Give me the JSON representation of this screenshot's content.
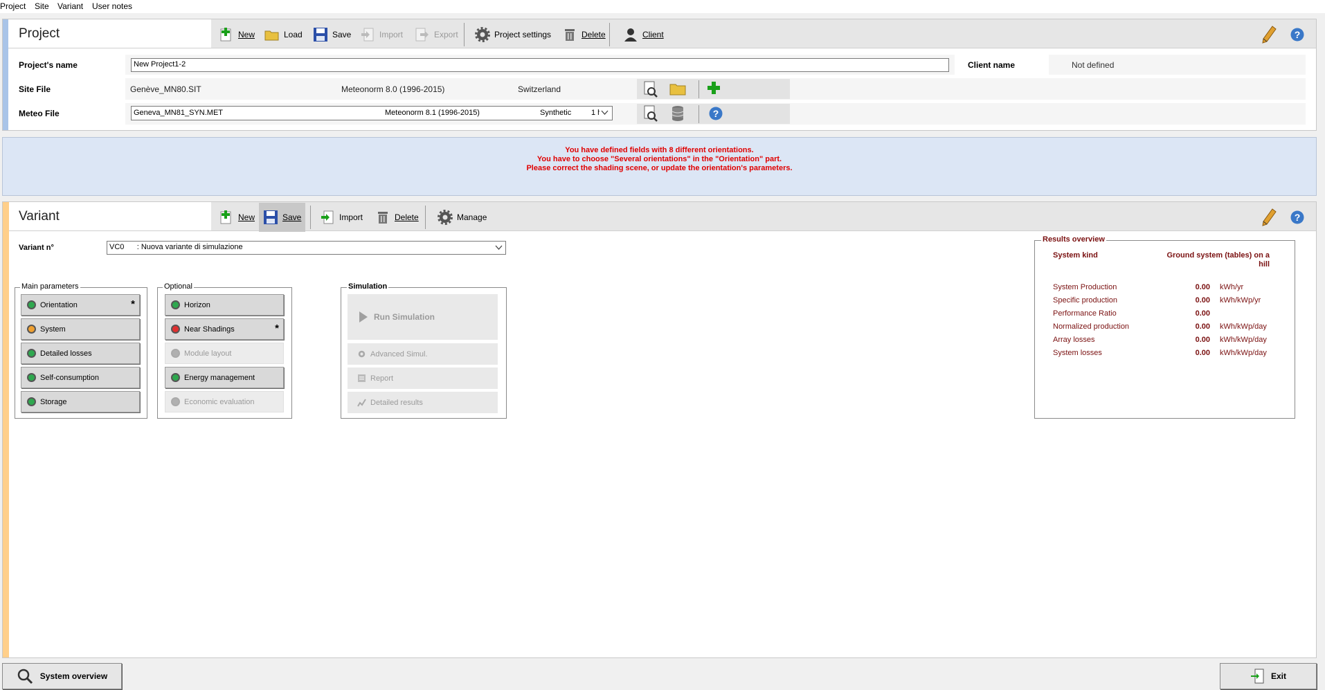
{
  "menu": [
    "Project",
    "Site",
    "Variant",
    "User notes"
  ],
  "project": {
    "title": "Project",
    "toolbar": {
      "new": "New",
      "load": "Load",
      "save": "Save",
      "import": "Import",
      "export": "Export",
      "settings": "Project settings",
      "delete": "Delete",
      "client": "Client"
    },
    "name_label": "Project's name",
    "name_value": "New Project1-2",
    "client_label": "Client name",
    "client_value": "Not defined",
    "site_label": "Site File",
    "site_file": "Genève_MN80.SIT",
    "site_source": "Meteonorm 8.0 (1996-2015)",
    "site_country": "Switzerland",
    "meteo_label": "Meteo File",
    "meteo_file": "Geneva_MN81_SYN.MET",
    "meteo_source": "Meteonorm 8.1 (1996-2015)",
    "meteo_type": "Synthetic",
    "meteo_step": "1 h"
  },
  "warning": {
    "line1": "You have defined fields with 8 different orientations.",
    "line2": "You have to choose \"Several orientations\" in the \"Orientation\" part.",
    "line3": "Please correct the shading scene, or update the orientation's parameters.",
    "color": "#e00000"
  },
  "variant": {
    "title": "Variant",
    "toolbar": {
      "new": "New",
      "save": "Save",
      "import": "Import",
      "delete": "Delete",
      "manage": "Manage"
    },
    "number_label": "Variant n°",
    "number_value": "VC0      : Nuova variante di simulazione"
  },
  "main_parameters": {
    "title": "Main parameters",
    "buttons": [
      {
        "label": "Orientation",
        "status": "green",
        "star": "*"
      },
      {
        "label": "System",
        "status": "orange",
        "star": ""
      },
      {
        "label": "Detailed losses",
        "status": "green",
        "star": ""
      },
      {
        "label": "Self-consumption",
        "status": "green",
        "star": ""
      },
      {
        "label": "Storage",
        "status": "green",
        "star": ""
      }
    ]
  },
  "optional": {
    "title": "Optional",
    "buttons": [
      {
        "label": "Horizon",
        "status": "green",
        "star": ""
      },
      {
        "label": "Near Shadings",
        "status": "red",
        "star": "*"
      },
      {
        "label": "Module layout",
        "status": "grey",
        "star": ""
      },
      {
        "label": "Energy management",
        "status": "green",
        "star": ""
      },
      {
        "label": "Economic evaluation",
        "status": "grey",
        "star": ""
      }
    ]
  },
  "simulation": {
    "title": "Simulation",
    "run": "Run Simulation",
    "advanced": "Advanced Simul.",
    "report": "Report",
    "detailed": "Detailed results"
  },
  "results": {
    "title": "Results overview",
    "kind_label": "System kind",
    "kind_value_1": "Ground system (tables) on a",
    "kind_value_2": "hill",
    "rows": [
      {
        "name": "System Production",
        "value": "0.00",
        "unit": "kWh/yr"
      },
      {
        "name": "Specific production",
        "value": "0.00",
        "unit": "kWh/kWp/yr"
      },
      {
        "name": "Performance Ratio",
        "value": "0.00",
        "unit": ""
      },
      {
        "name": "Normalized production",
        "value": "0.00",
        "unit": "kWh/kWp/day"
      },
      {
        "name": "Array losses",
        "value": "0.00",
        "unit": "kWh/kWp/day"
      },
      {
        "name": "System losses",
        "value": "0.00",
        "unit": "kWh/kWp/day"
      }
    ]
  },
  "footer": {
    "overview": "System overview",
    "exit": "Exit"
  },
  "colors": {
    "led_green": "#2fa84f",
    "led_orange": "#f0a030",
    "led_red": "#e03030",
    "led_grey": "#b0b0b0",
    "result_text": "#7a1010"
  }
}
